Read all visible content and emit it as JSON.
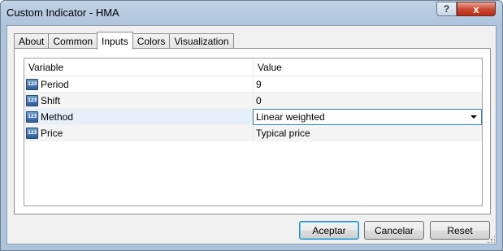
{
  "window": {
    "title": "Custom Indicator - HMA",
    "help_label": "?",
    "close_label": "x"
  },
  "tabs": [
    {
      "label": "About"
    },
    {
      "label": "Common"
    },
    {
      "label": "Inputs"
    },
    {
      "label": "Colors"
    },
    {
      "label": "Visualization"
    }
  ],
  "active_tab": "Inputs",
  "grid": {
    "columns": {
      "variable": "Variable",
      "value": "Value"
    },
    "type_icon_text": "123",
    "rows": [
      {
        "variable": "Period",
        "value": "9"
      },
      {
        "variable": "Shift",
        "value": "0"
      },
      {
        "variable": "Method",
        "value": "Linear weighted"
      },
      {
        "variable": "Price",
        "value": "Typical price"
      }
    ]
  },
  "buttons": {
    "accept": "Aceptar",
    "cancel": "Cancelar",
    "reset": "Reset"
  }
}
